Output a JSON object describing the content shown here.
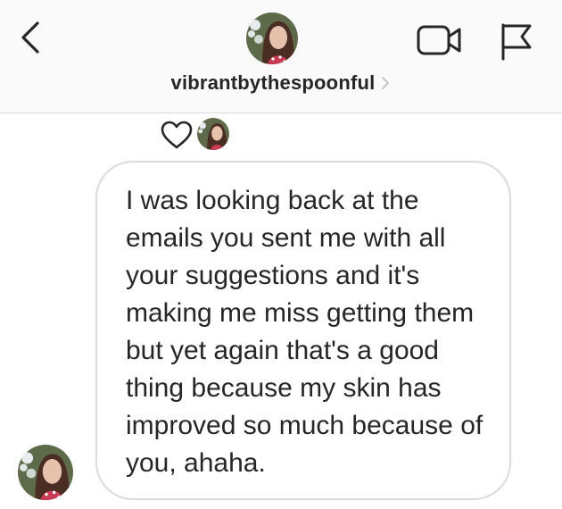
{
  "header": {
    "username": "vibrantbythespoonful",
    "icons": {
      "back": "chevron-left-icon",
      "video": "video-camera-icon",
      "flag": "flag-icon",
      "chevron": "chevron-right-icon"
    }
  },
  "conversation": {
    "reaction": {
      "icon": "heart-outline-icon"
    },
    "message": {
      "text": "I was looking back at the emails you sent me with all your suggestions and it's making me miss getting them but yet again that's a good thing because my skin has improved so much because of you, ahaha."
    }
  },
  "colors": {
    "header_bg": "#fafafa",
    "divider": "#dbdbdb",
    "text": "#262626",
    "chevron": "#c7c7c7",
    "bubble_border": "#dbdbdb"
  }
}
